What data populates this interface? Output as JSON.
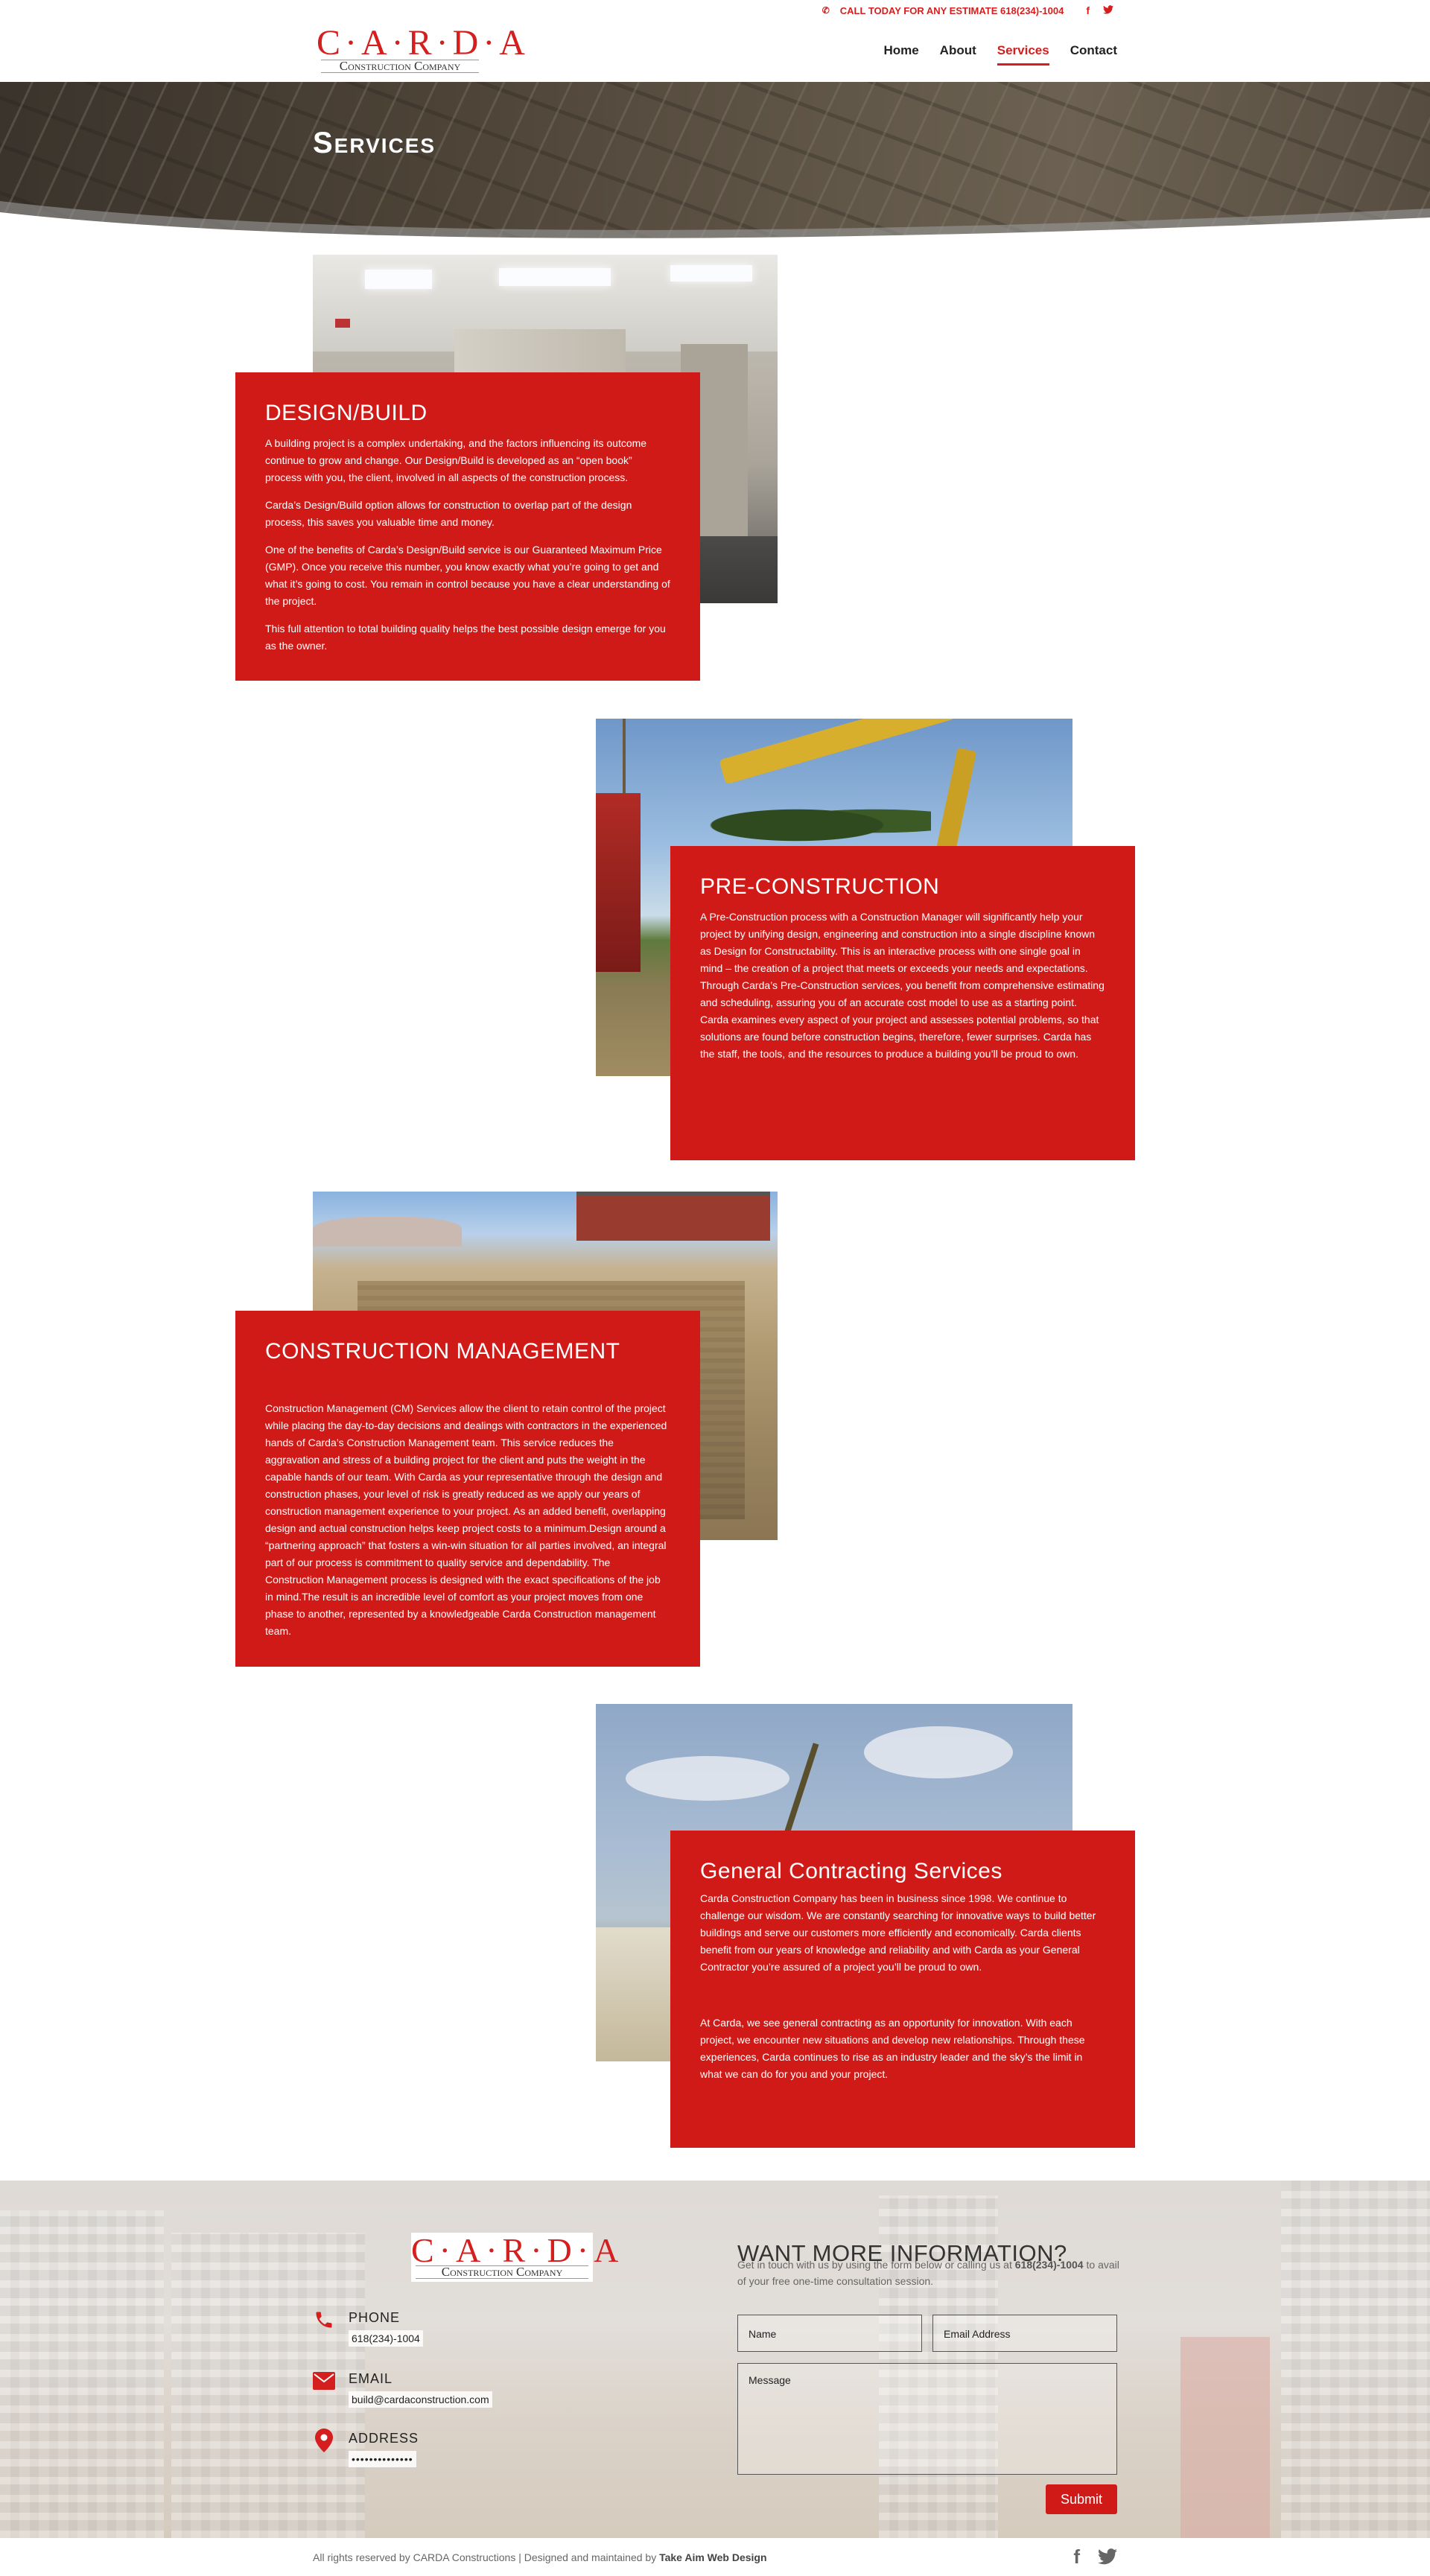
{
  "header": {
    "cta": "CALL TODAY FOR ANY ESTIMATE 618(234)-1004",
    "social": [
      {
        "icon": "facebook-icon",
        "glyph": "f"
      },
      {
        "icon": "twitter-icon",
        "glyph": "🐦"
      }
    ],
    "logo": {
      "title": "C·A·R·D·A",
      "subtitle": "Construction Company"
    },
    "nav": [
      {
        "label": "Home",
        "active": false
      },
      {
        "label": "About",
        "active": false
      },
      {
        "label": "Services",
        "active": true
      },
      {
        "label": "Contact",
        "active": false
      }
    ]
  },
  "hero": {
    "title": "Services"
  },
  "services": [
    {
      "title": "DESIGN/BUILD",
      "paragraphs": [
        "A building project is a complex undertaking, and the factors influencing its outcome continue to grow and change. Our Design/Build is developed as an “open book” process with you, the client, involved in all aspects of the construction process.",
        "Carda’s Design/Build option allows for construction to overlap part of the design process, this saves you valuable time and money.",
        "One of the benefits of Carda’s Design/Build service is our Guaranteed Maximum Price (GMP). Once you receive this number, you know exactly what you’re going to get and what it’s going to cost. You remain in control because you have a clear understanding of the project.",
        "This full attention to total building quality helps the best possible design emerge for you as the owner."
      ]
    },
    {
      "title": "PRE-CONSTRUCTION",
      "paragraphs": [
        "A Pre-Construction process with a Construction Manager will significantly help your project by unifying design, engineering and construction into a single discipline known as Design for Constructability. This is an interactive process with one single goal in mind – the creation of a project that meets or exceeds your needs and expectations.",
        "Through Carda’s Pre-Construction services, you benefit from comprehensive estimating and scheduling, assuring you of an accurate cost model to use as a starting point. Carda examines every aspect of your project and assesses potential problems, so that solutions are found before construction begins, therefore, fewer surprises. Carda has the staff, the tools, and the resources to produce a building you’ll be proud to own."
      ]
    },
    {
      "title": "CONSTRUCTION MANAGEMENT",
      "paragraphs": [
        "Construction Management (CM) Services allow the client to retain control of the project while placing the day-to-day decisions and dealings with contractors in the experienced hands of Carda’s Construction Management team. This service reduces the aggravation and stress of a building project for the client and puts the weight in the capable hands of our team. With Carda as your representative through the design and construction phases, your level of risk is greatly reduced as we apply our years of construction management experience to your project. As an added benefit, overlapping design and actual construction helps keep project costs to a minimum.Design around a “partnering approach” that fosters a win-win situation for all parties involved, an integral part of our process is commitment to quality service and dependability. The Construction Management process is designed with the exact specifications of the job in mind.The result is an incredible level of comfort as your project moves from one phase to another, represented by a knowledgeable Carda Construction management team."
      ]
    },
    {
      "title": "General Contracting Services",
      "paragraphs": [
        "Carda Construction Company has been in business since 1998. We continue to challenge our wisdom. We are constantly searching for innovative ways to build better buildings and serve our customers more efficiently and economically. Carda clients benefit from our years of knowledge and reliability and with Carda as your General Contractor you’re assured of a project you’ll be proud to own.",
        "At Carda, we see general contracting as an opportunity for innovation. With each project, we encounter new situations and develop new relationships. Through these experiences, Carda continues to rise as an industry leader and the sky’s the limit in what we can do for you and your project."
      ]
    }
  ],
  "footer": {
    "logo": {
      "title": "C·A·R·D·A",
      "subtitle": "Construction Company"
    },
    "contacts": [
      {
        "icon": "phone-icon",
        "label": "PHONE",
        "value": "618(234)-1004"
      },
      {
        "icon": "email-icon",
        "label": "EMAIL",
        "value": "build@cardaconstruction.com"
      },
      {
        "icon": "location-pin-icon",
        "label": "ADDRESS",
        "value": "••••••••••••••"
      }
    ],
    "form": {
      "heading": "WANT MORE INFORMATION?",
      "intro_before": "Get in touch with us by using the form below or calling us at ",
      "intro_phone": "618(234)-1004",
      "intro_after": " to avail of your free one-time consultation session.",
      "name_placeholder": "Name",
      "email_placeholder": "Email Address",
      "message_placeholder": "Message",
      "submit_label": "Submit"
    },
    "copyright_before": "All rights reserved by CARDA Constructions | Designed and maintained by ",
    "copyright_link": "Take Aim Web Design",
    "social": [
      {
        "icon": "facebook-icon",
        "glyph": "f"
      },
      {
        "icon": "twitter-icon",
        "glyph": "🐦"
      }
    ]
  },
  "colors": {
    "accent": "#d01a18",
    "text": "#333333"
  }
}
